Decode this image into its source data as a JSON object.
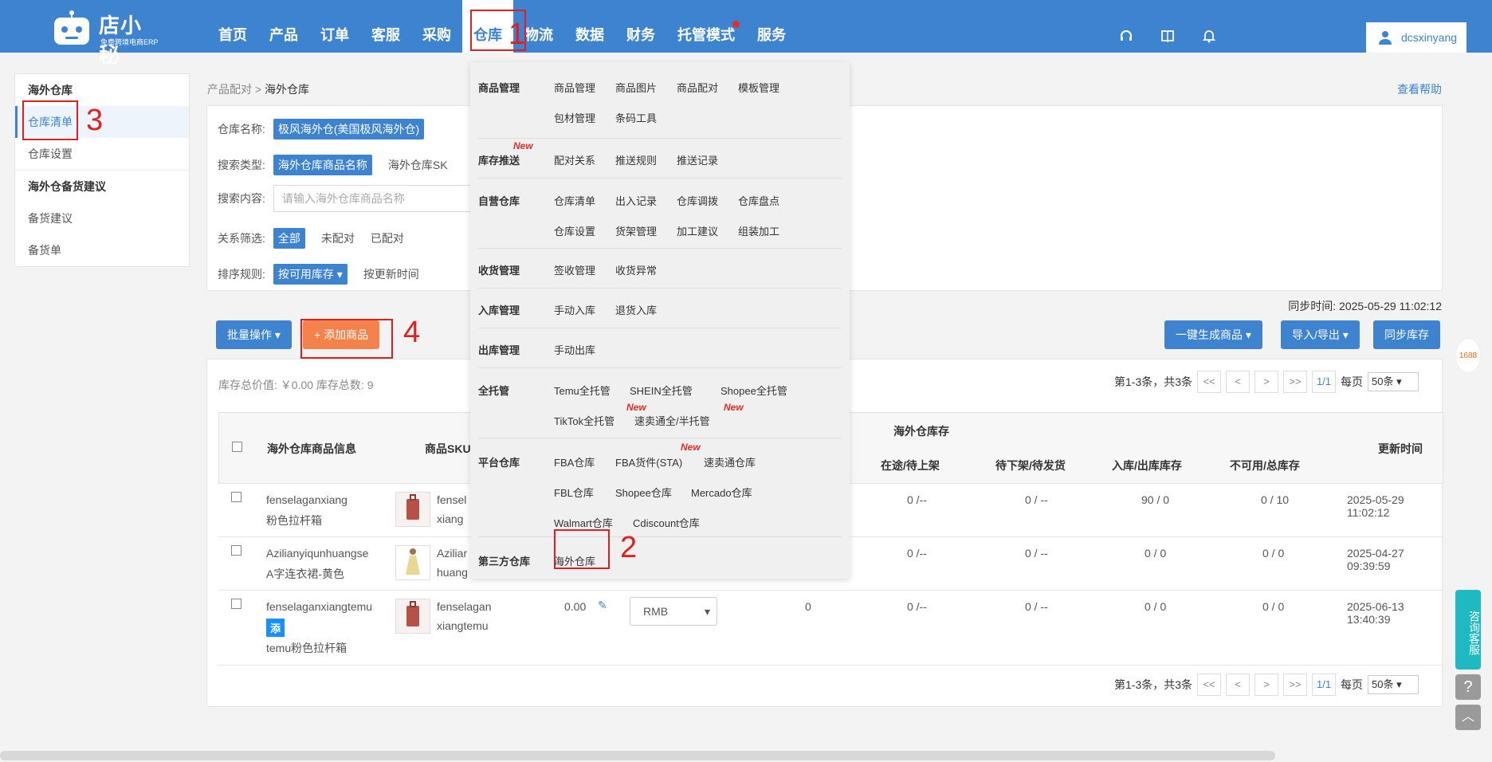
{
  "header": {
    "logo": {
      "title": "店小秘",
      "subtitle": "免费跨境电商ERP"
    },
    "nav": [
      "首页",
      "产品",
      "订单",
      "客服",
      "采购",
      "仓库",
      "物流",
      "数据",
      "财务",
      "托管模式",
      "服务"
    ],
    "username": "dcsxinyang"
  },
  "sidebar": {
    "group1": "海外仓库",
    "item1": "仓库清单",
    "item2": "仓库设置",
    "group2": "海外仓备货建议",
    "item3": "备货建议",
    "item4": "备货单"
  },
  "breadcrumb": {
    "parent": "产品配对",
    "sep": ">",
    "current": "海外仓库"
  },
  "help": "查看帮助",
  "filters": {
    "warehouse_label": "仓库名称:",
    "warehouse_value": "极风海外仓(美国极风海外仓)",
    "search_type_label": "搜索类型:",
    "search_type_active": "海外仓库商品名称",
    "search_type_other": "海外仓库SK",
    "content_label": "搜索内容:",
    "content_placeholder": "请输入海外仓库商品名称",
    "relation_label": "关系筛选:",
    "relation_options": [
      "全部",
      "未配对",
      "已配对"
    ],
    "sort_label": "排序规则:",
    "sort_active": "按可用库存 ▾",
    "sort_other": "按更新时间"
  },
  "sync_time": "同步时间: 2025-05-29 11:02:12",
  "buttons": {
    "batch": "批量操作",
    "add": "+ 添加商品",
    "generate": "一键生成商品",
    "import_export": "导入/导出",
    "sync": "同步库存"
  },
  "totals": "库存总价值: ￥0.00 库存总数: 9",
  "pager": {
    "summary": "第1-3条，共3条",
    "first": "<<",
    "prev": "<",
    "next": ">",
    "last": ">>",
    "page": "1/1",
    "per_page_label": "每页",
    "per_page": "50条"
  },
  "table": {
    "headers": {
      "info": "海外仓库商品信息",
      "sku": "商品SKU",
      "overseas_stock": "海外仓库存",
      "in_transit": "在途/待上架",
      "pending": "待下架/待发货",
      "in_out": "入库/出库库存",
      "unavailable": "不可用/总库存",
      "updated": "更新时间"
    },
    "rows": [
      {
        "name": "fenselaganxiang",
        "desc": "粉色拉杆箱",
        "sku1": "fensel",
        "sku2": "xiang",
        "in_transit": "0 /--",
        "pending": "0 / --",
        "in_out": "90 / 0",
        "unavailable": "0 / 10",
        "updated": "2025-05-29 11:02:12"
      },
      {
        "name": "Azilianyiqunhuangse",
        "desc": "A字连衣裙-黄色",
        "sku1": "Aziliar",
        "sku2": "huang",
        "in_transit": "0 /--",
        "pending": "0 / --",
        "in_out": "0 / 0",
        "unavailable": "0 / 0",
        "updated": "2025-04-27 09:39:59"
      },
      {
        "name": "fenselaganxiangtemu",
        "badge": "添",
        "desc": "temu粉色拉杆箱",
        "sku1": "fenselagan",
        "sku2": "xiangtemu",
        "price": "0.00",
        "currency": "RMB",
        "stock": "0",
        "in_transit": "0 /--",
        "pending": "0 / --",
        "in_out": "0 / 0",
        "unavailable": "0 / 0",
        "updated": "2025-06-13 13:40:39"
      }
    ]
  },
  "dropdown": {
    "goods": {
      "head": "商品管理",
      "links": [
        "商品管理",
        "商品图片",
        "商品配对",
        "模板管理",
        "包材管理",
        "条码工具"
      ]
    },
    "push": {
      "head": "库存推送",
      "new": "New",
      "links": [
        "配对关系",
        "推送规则",
        "推送记录"
      ]
    },
    "self": {
      "head": "自营仓库",
      "links": [
        "仓库清单",
        "出入记录",
        "仓库调拨",
        "仓库盘点",
        "仓库设置",
        "货架管理",
        "加工建议",
        "组装加工"
      ]
    },
    "receive": {
      "head": "收货管理",
      "links": [
        "签收管理",
        "收货异常"
      ]
    },
    "inbound": {
      "head": "入库管理",
      "links": [
        "手动入库",
        "退货入库"
      ]
    },
    "outbound": {
      "head": "出库管理",
      "links": [
        "手动出库"
      ]
    },
    "managed": {
      "head": "全托管",
      "links": [
        "Temu全托管",
        "SHEIN全托管",
        "Shopee全托管",
        "TikTok全托管",
        "速卖通全/半托管"
      ],
      "new": "New"
    },
    "platform": {
      "head": "平台仓库",
      "links": [
        "FBA仓库",
        "FBA货件(STA)",
        "速卖通仓库",
        "FBL仓库",
        "Shopee仓库",
        "Mercado仓库",
        "Walmart仓库",
        "Cdiscount仓库"
      ],
      "new": "New"
    },
    "third": {
      "head": "第三方仓库",
      "links": [
        "海外仓库"
      ]
    }
  },
  "annotations": [
    "1",
    "2",
    "3",
    "4"
  ],
  "float": {
    "consult": "咨询客服",
    "badge": "1688",
    "help": "?"
  }
}
